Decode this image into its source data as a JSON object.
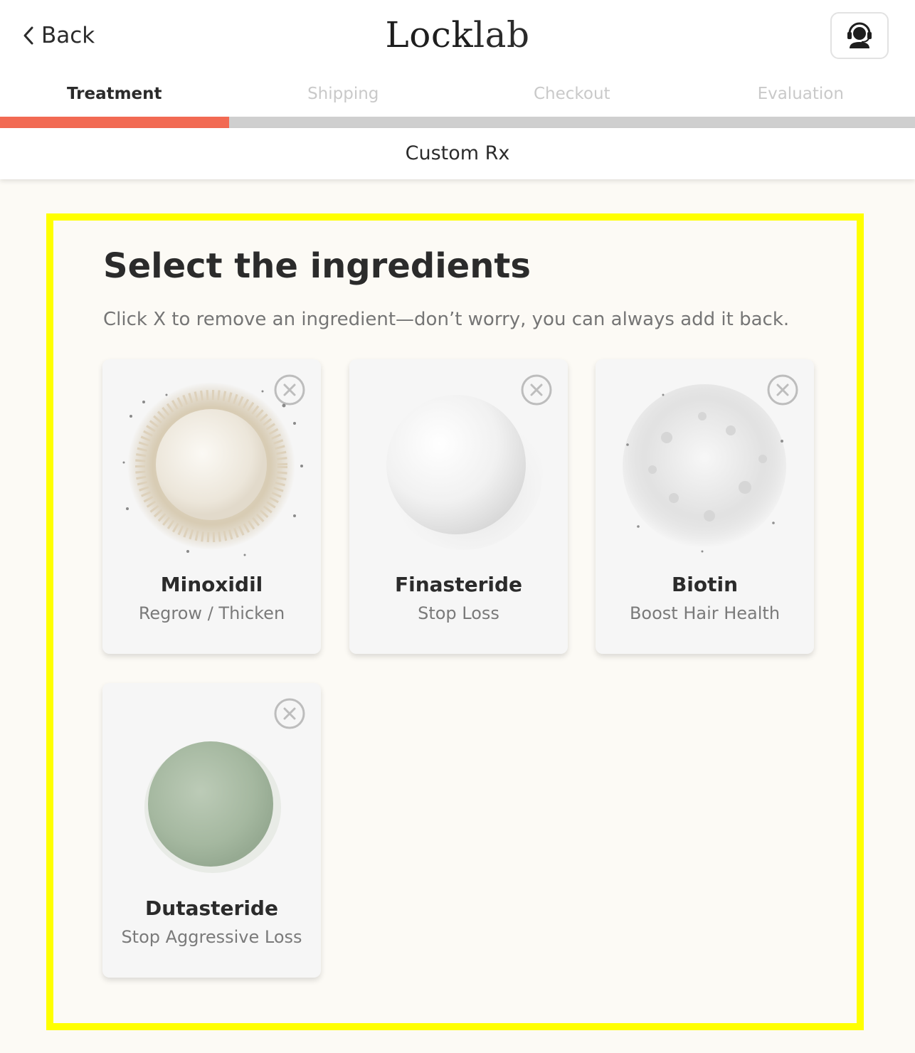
{
  "header": {
    "back_label": "Back",
    "logo_bold": "Lock",
    "logo_light": "lab",
    "support_icon": "support-agent-icon"
  },
  "steps": [
    {
      "label": "Treatment",
      "active": true
    },
    {
      "label": "Shipping",
      "active": false
    },
    {
      "label": "Checkout",
      "active": false
    },
    {
      "label": "Evaluation",
      "active": false
    }
  ],
  "progress": {
    "completed_steps": 1,
    "total_steps": 4,
    "fill_color": "#f26a53",
    "track_color": "#cfcfcf"
  },
  "subheader": {
    "title": "Custom Rx"
  },
  "main": {
    "title": "Select the ingredients",
    "subtitle": "Click X to remove an ingredient—don’t worry, you can always add it back.",
    "highlight_color": "#ffff00",
    "ingredients": [
      {
        "name": "Minoxidil",
        "description": "Regrow / Thicken",
        "powder": "minoxidil-powder-image",
        "color": "#ece6da"
      },
      {
        "name": "Finasteride",
        "description": "Stop Loss",
        "powder": "finasteride-powder-image",
        "color": "#f2f2f2"
      },
      {
        "name": "Biotin",
        "description": "Boost Hair Health",
        "powder": "biotin-powder-image",
        "color": "#e6e6e6"
      },
      {
        "name": "Dutasteride",
        "description": "Stop Aggressive Loss",
        "powder": "dutasteride-powder-image",
        "color": "#a9bca5"
      }
    ]
  }
}
